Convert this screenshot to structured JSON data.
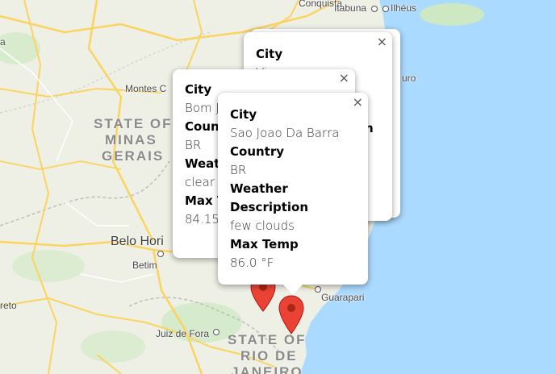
{
  "map": {
    "colors": {
      "land": "#eef0e6",
      "water": "#aadaff",
      "road": "#fbd35f",
      "border": "#bdbdbd",
      "green": "#cde8c2"
    },
    "labels": {
      "conquista": "Conquista",
      "itabuna": "Itabuna",
      "ilheus": "Ilhéus",
      "montes": "Montes C",
      "belo": "Belo Hori",
      "betim": "Betim",
      "juiz": "Juiz de Fora",
      "guarapari": "Guarapari",
      "oreto": "reto",
      "uro": "uro",
      "a_left": "a"
    },
    "states": {
      "minas": [
        "STATE OF",
        "MINAS",
        "GERAIS"
      ],
      "rio": [
        "STATE OF",
        "RIO DE",
        "JANEIRO"
      ]
    }
  },
  "popups": [
    {
      "id": "back",
      "close": "×",
      "city_label": "City",
      "city_value": "Vi"
    },
    {
      "id": "middle",
      "close": "×",
      "city_label": "City",
      "city_value": "Bom J",
      "country_label": "Count",
      "country_value": "BR",
      "weather_label": "Weath",
      "weather_value": "clear s",
      "maxtemp_label": "Max T",
      "maxtemp_value": "84.15"
    },
    {
      "id": "front",
      "close": "×",
      "city_label": "City",
      "city_value": "Sao Joao Da Barra",
      "country_label": "Country",
      "country_value": "BR",
      "weather_label": "Weather Description",
      "weather_value": "few clouds",
      "maxtemp_label": "Max Temp",
      "maxtemp_value": "86.0 °F"
    }
  ],
  "back_peek": {
    "fragment": "n"
  },
  "markers": [
    "map-marker-icon",
    "map-marker-icon"
  ]
}
